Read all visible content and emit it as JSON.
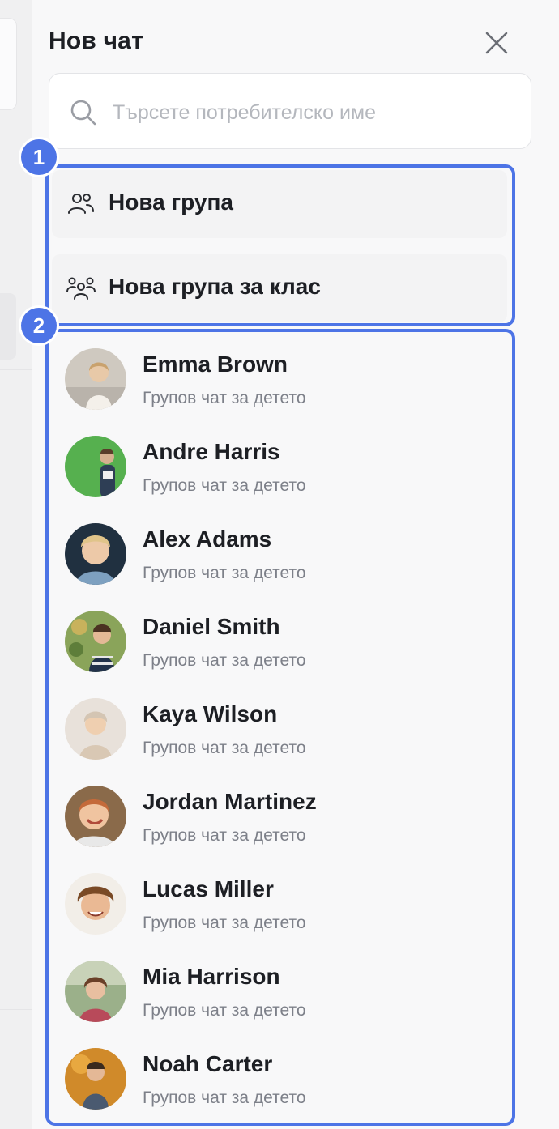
{
  "header": {
    "title": "Нов чат"
  },
  "search": {
    "placeholder": "Търсете потребителско име",
    "value": ""
  },
  "badges": [
    "1",
    "2"
  ],
  "actions": [
    {
      "label": "Нова група",
      "icon": "group-icon"
    },
    {
      "label": "Нова група за клас",
      "icon": "class-group-icon"
    }
  ],
  "contacts": [
    {
      "name": "Emma Brown",
      "subtitle": "Групов чат за детето"
    },
    {
      "name": "Andre Harris",
      "subtitle": "Групов чат за детето"
    },
    {
      "name": "Alex Adams",
      "subtitle": "Групов чат за детето"
    },
    {
      "name": "Daniel Smith",
      "subtitle": "Групов чат за детето"
    },
    {
      "name": "Kaya Wilson",
      "subtitle": "Групов чат за детето"
    },
    {
      "name": "Jordan Martinez",
      "subtitle": "Групов чат за детето"
    },
    {
      "name": "Lucas Miller",
      "subtitle": "Групов чат за детето"
    },
    {
      "name": "Mia Harrison",
      "subtitle": "Групов чат за детето"
    },
    {
      "name": "Noah Carter",
      "subtitle": "Групов чат за детето"
    }
  ],
  "colors": {
    "highlight": "#4d74e6",
    "panel": "#f8f8f9",
    "text": "#1d1f24",
    "subtext": "#7d8089"
  }
}
